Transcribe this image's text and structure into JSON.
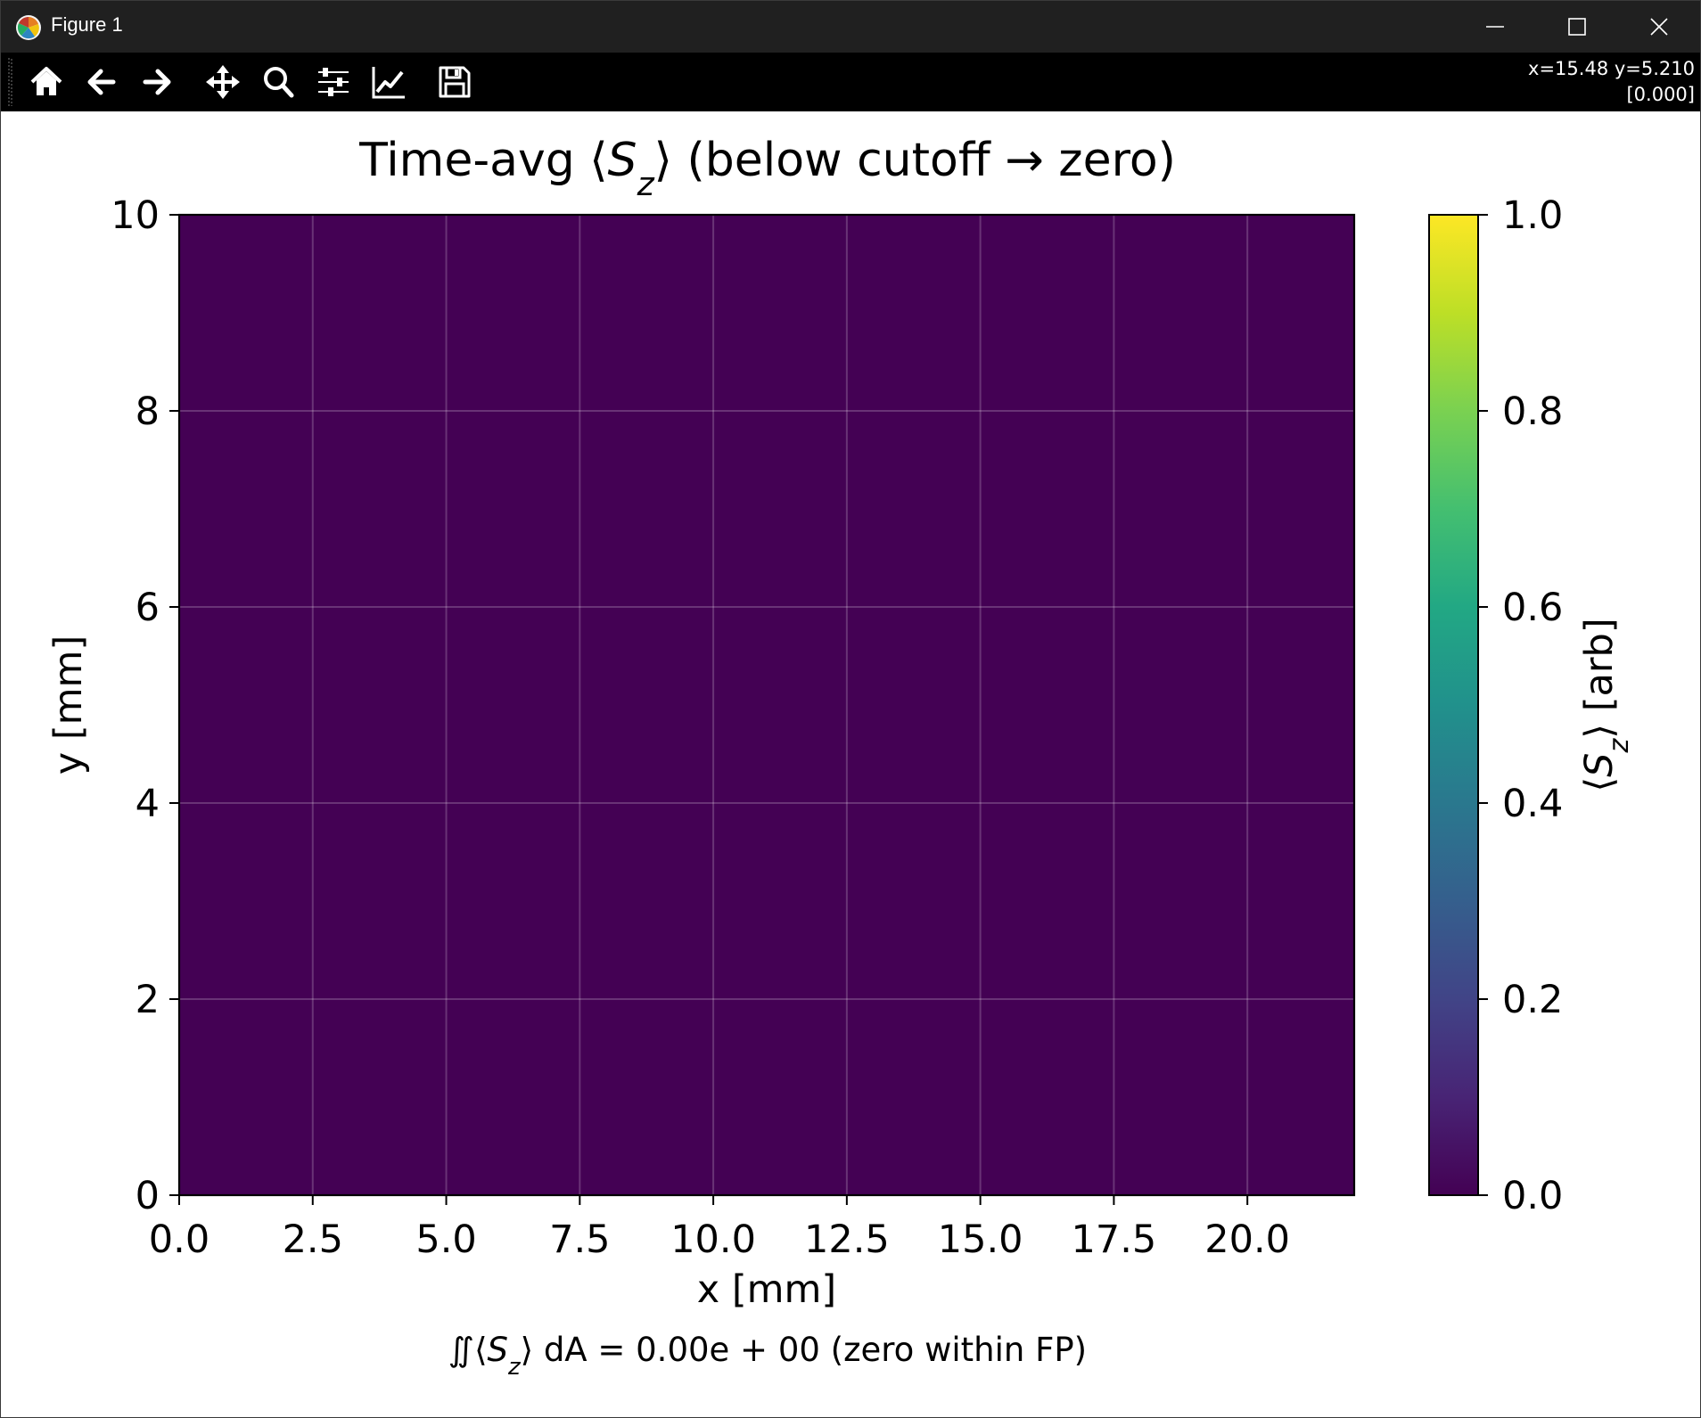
{
  "window": {
    "title": "Figure 1",
    "controls": [
      "minimize",
      "maximize",
      "close"
    ]
  },
  "toolbar": {
    "tools": [
      {
        "name": "home-icon",
        "tooltip": "Reset original view"
      },
      {
        "name": "back-icon",
        "tooltip": "Back to previous view"
      },
      {
        "name": "forward-icon",
        "tooltip": "Forward to next view"
      },
      {
        "name": "pan-icon",
        "tooltip": "Pan axes"
      },
      {
        "name": "zoom-icon",
        "tooltip": "Zoom to rectangle"
      },
      {
        "name": "configure-subplots-icon",
        "tooltip": "Configure subplots"
      },
      {
        "name": "edit-axis-icon",
        "tooltip": "Edit axis, curve and image parameters"
      },
      {
        "name": "save-icon",
        "tooltip": "Save the figure"
      }
    ],
    "coords_line1": "x=15.48 y=5.210",
    "coords_line2": "[0.000]"
  },
  "chart_data": {
    "type": "heatmap",
    "title": "Time-avg ⟨S_z⟩ (below cutoff → zero)",
    "xlabel": "x [mm]",
    "ylabel": "y [mm]",
    "xlim": [
      0,
      22
    ],
    "ylim": [
      0,
      10
    ],
    "xticks": [
      "0.0",
      "2.5",
      "5.0",
      "7.5",
      "10.0",
      "12.5",
      "15.0",
      "17.5",
      "20.0"
    ],
    "yticks": [
      "0",
      "2",
      "4",
      "6",
      "8",
      "10"
    ],
    "grid": true,
    "values": "all 0 (uniform field)",
    "colormap": "viridis",
    "fill_color": "#440154",
    "colorbar": {
      "label": "⟨S_z⟩ [arb]",
      "range": [
        0.0,
        1.0
      ],
      "ticks": [
        "0.0",
        "0.2",
        "0.4",
        "0.6",
        "0.8",
        "1.0"
      ]
    },
    "annotation": "∬⟨S_z⟩ dA = 0.00e + 00  (zero within FP)"
  }
}
